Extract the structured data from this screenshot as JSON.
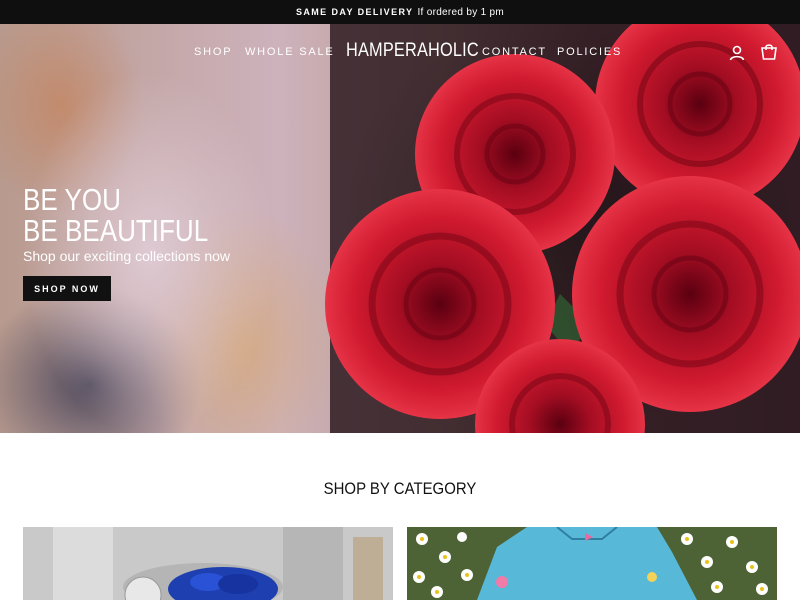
{
  "announcement": {
    "strong": "SAME DAY DELIVERY",
    "text": "If ordered by 1 pm"
  },
  "nav": {
    "left": [
      "SHOP",
      "WHOLE SALE"
    ],
    "logo": "HAMPERAHOLIC",
    "right": [
      "CONTACT",
      "POLICIES"
    ],
    "icons": [
      "user-icon",
      "cart-icon"
    ]
  },
  "hero": {
    "title_line1": "BE YOU",
    "title_line2": "BE BEAUTIFUL",
    "subtitle": "Shop our exciting collections now",
    "button": "SHOP NOW",
    "image": "red-roses-bouquet"
  },
  "categories": {
    "heading": "SHOP BY CATEGORY",
    "cards": [
      {
        "image": "blue-rose-glass-jar"
      },
      {
        "image": "blue-plush-star-on-daisies"
      }
    ]
  },
  "colors": {
    "announcement_bg": "#0f0f0f",
    "button_bg": "#111111",
    "rose": "#c8102e"
  }
}
